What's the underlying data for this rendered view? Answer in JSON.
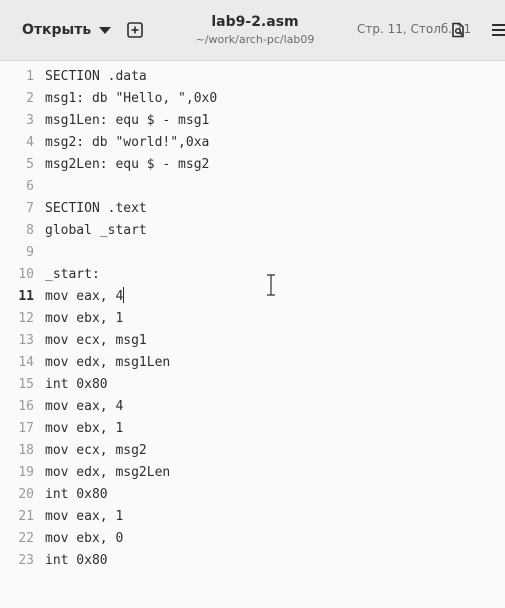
{
  "header": {
    "open_label": "Открыть",
    "title": "lab9-2.asm",
    "path": "~/work/arch-pc/lab09",
    "cursor_position": "Стр. 11, Столб. 11",
    "icons": {
      "open_dropdown": "chevron-down-icon",
      "new_tab": "new-tab-icon",
      "document": "document-search-icon",
      "menu": "hamburger-menu-icon"
    }
  },
  "editor": {
    "current_line": 11,
    "lines": [
      "SECTION .data",
      "msg1: db \"Hello, \",0x0",
      "msg1Len: equ $ - msg1",
      "msg2: db \"world!\",0xa",
      "msg2Len: equ $ - msg2",
      "",
      "SECTION .text",
      "global _start",
      "",
      "_start:",
      "mov eax, 4",
      "mov ebx, 1",
      "mov ecx, msg1",
      "mov edx, msg1Len",
      "int 0x80",
      "mov eax, 4",
      "mov ebx, 1",
      "mov ecx, msg2",
      "mov edx, msg2Len",
      "int 0x80",
      "mov eax, 1",
      "mov ebx, 0",
      "int 0x80"
    ]
  },
  "colors": {
    "header_bg": "#ebebeb",
    "editor_bg": "#fafafa",
    "text": "#2e2e2e",
    "line_number": "#9a9a9a",
    "spellcheck_underline": "#c01c28"
  }
}
